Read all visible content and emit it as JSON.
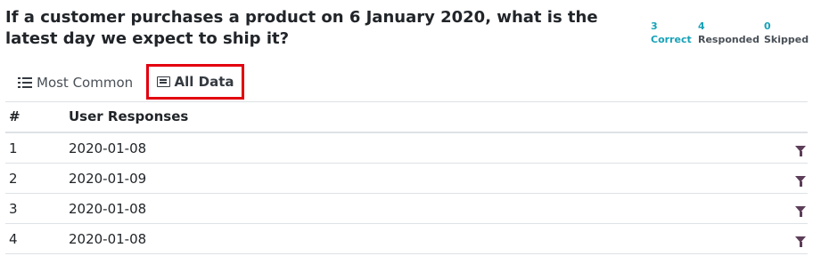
{
  "question": {
    "text": "If a customer purchases a product on 6 January 2020, what is the latest day we expect to ship it?"
  },
  "stats": {
    "correct": {
      "value": "3",
      "label": "Correct"
    },
    "responded": {
      "value": "4",
      "label": "Responded"
    },
    "skipped": {
      "value": "0",
      "label": "Skipped"
    }
  },
  "tabs": {
    "most_common": {
      "label": "Most Common",
      "icon": "list-icon"
    },
    "all_data": {
      "label": "All Data",
      "icon": "table-icon",
      "active": true
    }
  },
  "table": {
    "headers": [
      "#",
      "User Responses"
    ],
    "rows": [
      {
        "index": "1",
        "response": "2020-01-08"
      },
      {
        "index": "2",
        "response": "2020-01-09"
      },
      {
        "index": "3",
        "response": "2020-01-08"
      },
      {
        "index": "4",
        "response": "2020-01-08"
      }
    ],
    "row_action_icon": "filter-icon"
  },
  "colors": {
    "highlight_border": "#e3000f",
    "stat_number": "#17a2b8",
    "filter_icon": "#5c3d59"
  }
}
